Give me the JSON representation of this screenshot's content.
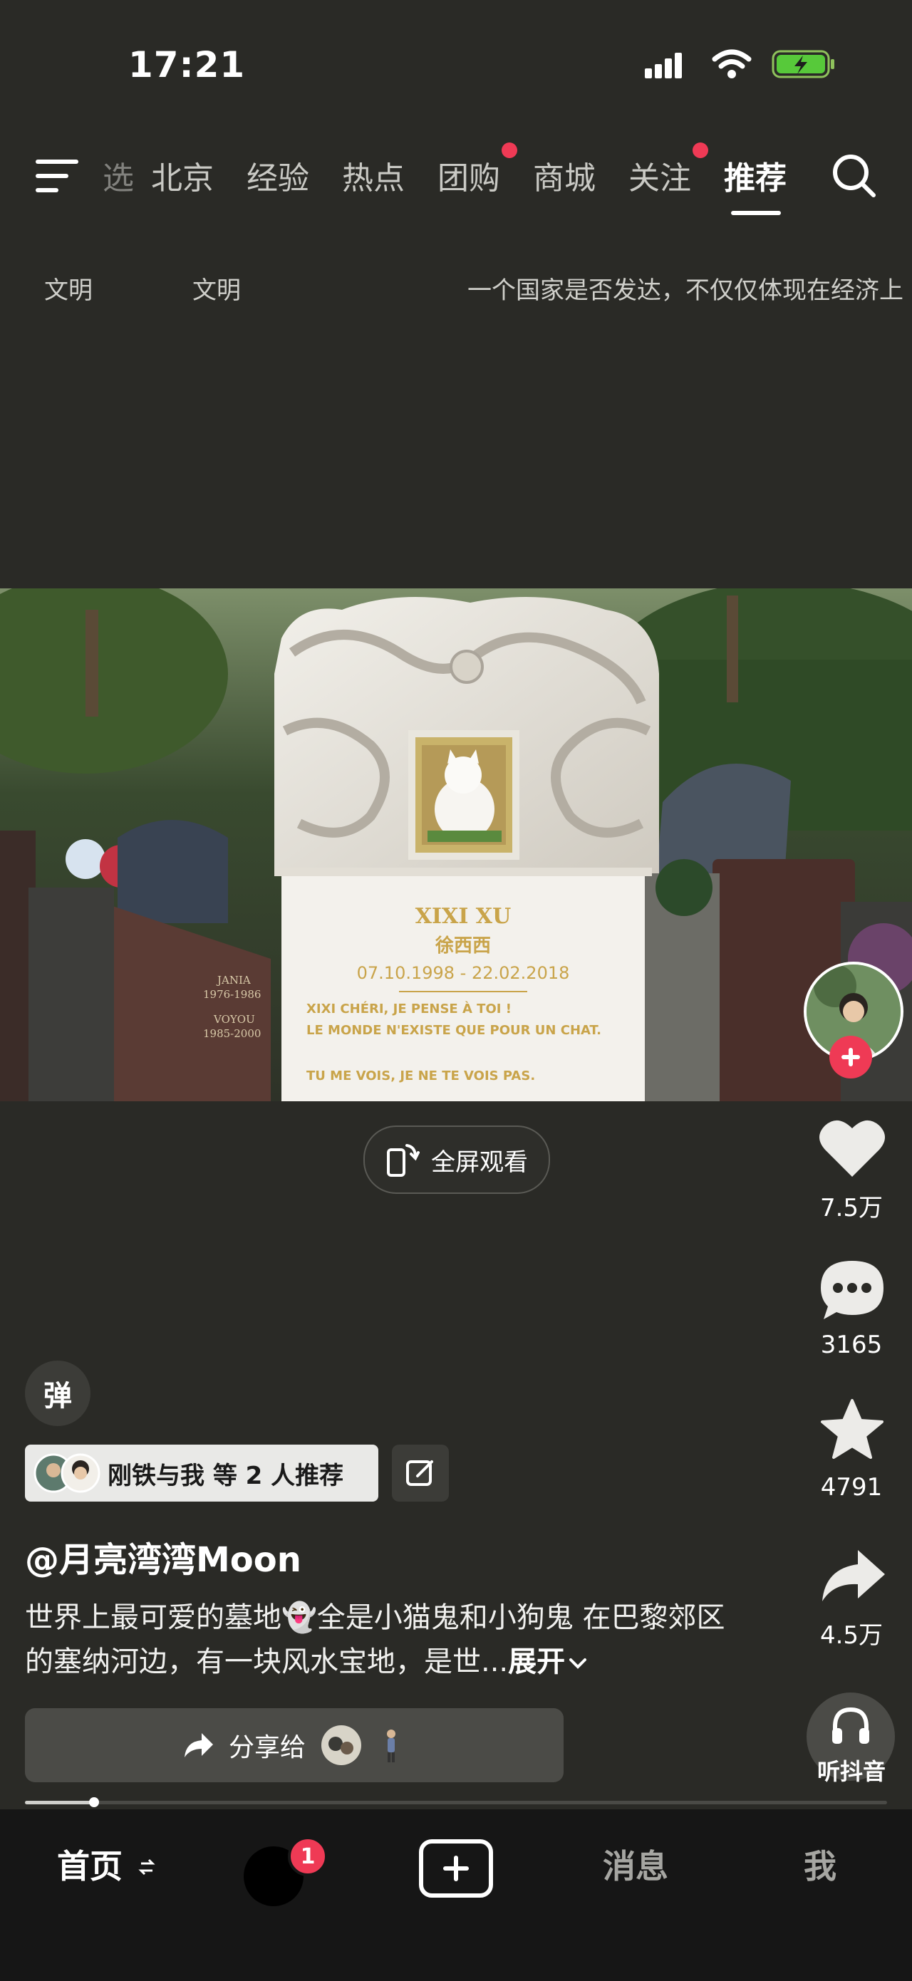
{
  "status_bar": {
    "time": "17:21"
  },
  "tabs": [
    {
      "label": "选"
    },
    {
      "label": "北京"
    },
    {
      "label": "经验"
    },
    {
      "label": "热点"
    },
    {
      "label": "团购"
    },
    {
      "label": "商城"
    },
    {
      "label": "关注"
    },
    {
      "label": "推荐"
    }
  ],
  "danmaku": [
    "文明",
    "文明",
    "一个国家是否发达，不仅仅体现在经济上"
  ],
  "video": {
    "tombstone": {
      "name_latin": "XIXI XU",
      "name_cn": "徐西西",
      "dates": "07.10.1998 - 22.02.2018",
      "epitaph_1": "XIXI CHÉRI, JE PENSE À TOI !",
      "epitaph_2": "LE MONDE N'EXISTE QUE POUR UN CHAT.",
      "epitaph_3": "TU ME VOIS, JE NE TE VOIS PAS."
    },
    "left_stone": {
      "line1": "JANIA",
      "line2": "1976-1986",
      "line3": "VOYOU",
      "line4": "1985-2000"
    }
  },
  "fullscreen_label": "全屏观看",
  "actions": {
    "likes": "7.5万",
    "comments": "3165",
    "favorites": "4791",
    "shares": "4.5万",
    "listen_label": "听抖音"
  },
  "danmu_toggle": "弹",
  "recommend": {
    "text": "刚铁与我 等 2 人推荐"
  },
  "author": "@月亮湾湾Moon",
  "description": "世界上最可爱的墓地👻全是小猫鬼和小狗鬼 在巴黎郊区的塞纳河边，有一块风水宝地，是世...",
  "expand_label": "展开",
  "share_to": "分享给",
  "progress": 0.08,
  "nav": {
    "home": "首页",
    "badge": "1",
    "messages": "消息",
    "me": "我"
  },
  "colors": {
    "accent_red": "#ef3a55",
    "background": "#2a2a26"
  }
}
